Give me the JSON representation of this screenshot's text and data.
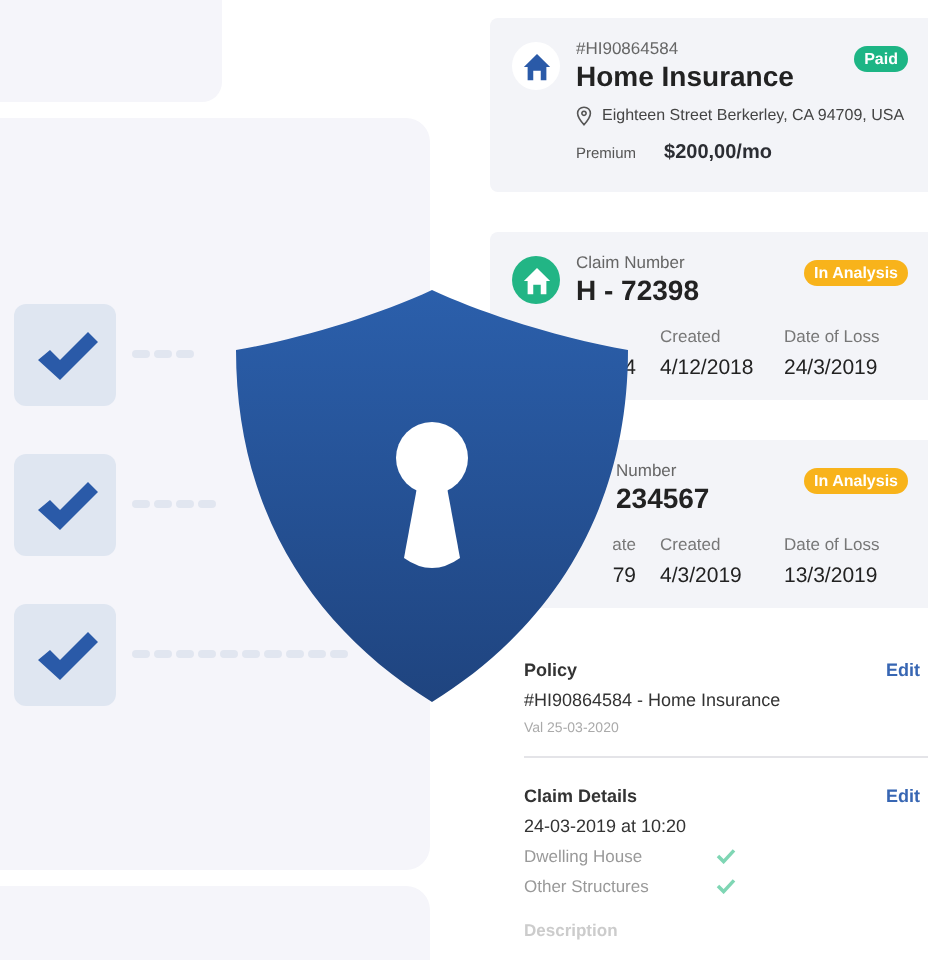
{
  "checklist": [
    {
      "checked": true
    },
    {
      "checked": true
    },
    {
      "checked": true
    }
  ],
  "policy_card": {
    "number": "#HI90864584",
    "title": "Home Insurance",
    "status": "Paid",
    "address": "Eighteen Street Berkerley, CA 94709, USA",
    "premium_label": "Premium",
    "premium": "$200,00/mo"
  },
  "claim_cards": [
    {
      "kind": "full",
      "label": "Claim Number",
      "number": "H - 72398",
      "status": "In Analysis",
      "columns": [
        {
          "value": "4"
        },
        {
          "label": "Created",
          "value": "4/12/2018"
        },
        {
          "label": "Date of Loss",
          "value": "24/3/2019"
        }
      ]
    },
    {
      "kind": "covered",
      "label": "Number",
      "number": "234567",
      "status": "In Analysis",
      "columns": [
        {
          "label": "ate",
          "value": "79"
        },
        {
          "label": "Created",
          "value": "4/3/2019"
        },
        {
          "label": "Date of Loss",
          "value": "13/3/2019"
        }
      ]
    }
  ],
  "details": {
    "policy": {
      "heading": "Policy",
      "edit": "Edit",
      "line": "#HI90864584 - Home Insurance",
      "validity": "Val 25-03-2020"
    },
    "claim": {
      "heading": "Claim Details",
      "edit": "Edit",
      "date": "24-03-2019 at 10:20",
      "items": [
        {
          "label": "Dwelling House",
          "checked": true
        },
        {
          "label": "Other Structures",
          "checked": true
        }
      ]
    },
    "description_heading": "Description"
  }
}
